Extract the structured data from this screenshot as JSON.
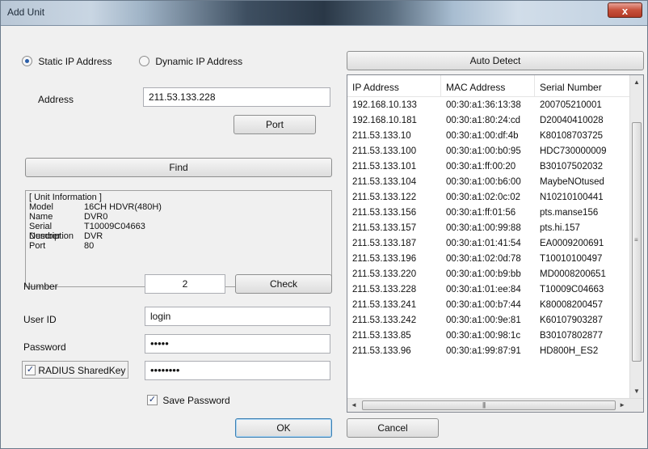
{
  "window": {
    "title": "Add Unit",
    "close_glyph": "x"
  },
  "connection": {
    "static_label": "Static IP Address",
    "dynamic_label": "Dynamic IP Address",
    "selected": "static"
  },
  "address": {
    "label": "Address",
    "value": "211.53.133.228"
  },
  "buttons": {
    "port": "Port",
    "find": "Find",
    "check": "Check",
    "auto_detect": "Auto Detect",
    "ok": "OK",
    "cancel": "Cancel"
  },
  "unit_info": {
    "heading": "[ Unit Information ]",
    "rows": [
      {
        "label": "Model",
        "value": "16CH HDVR(480H)"
      },
      {
        "label": "Name",
        "value": "DVR0"
      },
      {
        "label": "Serial Number",
        "value": "T10009C04663"
      },
      {
        "label": "Description",
        "value": "DVR"
      },
      {
        "label": "Port",
        "value": "80"
      }
    ]
  },
  "form": {
    "number_label": "Number",
    "number_value": "2",
    "userid_label": "User ID",
    "userid_value": "login",
    "password_label": "Password",
    "password_value": "•••••",
    "radius_label": "RADIUS SharedKey",
    "radius_checked": true,
    "radius_value": "••••••••",
    "save_password_label": "Save Password",
    "save_password_checked": true
  },
  "device_list": {
    "columns": [
      "IP Address",
      "MAC Address",
      "Serial Number"
    ],
    "rows": [
      [
        "192.168.10.133",
        "00:30:a1:36:13:38",
        "200705210001"
      ],
      [
        "192.168.10.181",
        "00:30:a1:80:24:cd",
        "D20040410028"
      ],
      [
        "211.53.133.10",
        "00:30:a1:00:df:4b",
        "K80108703725"
      ],
      [
        "211.53.133.100",
        "00:30:a1:00:b0:95",
        "HDC730000009"
      ],
      [
        "211.53.133.101",
        "00:30:a1:ff:00:20",
        "B30107502032"
      ],
      [
        "211.53.133.104",
        "00:30:a1:00:b6:00",
        "MaybeNOtused"
      ],
      [
        "211.53.133.122",
        "00:30:a1:02:0c:02",
        "N10210100441"
      ],
      [
        "211.53.133.156",
        "00:30:a1:ff:01:56",
        "pts.manse156"
      ],
      [
        "211.53.133.157",
        "00:30:a1:00:99:88",
        "pts.hi.157"
      ],
      [
        "211.53.133.187",
        "00:30:a1:01:41:54",
        "EA0009200691"
      ],
      [
        "211.53.133.196",
        "00:30:a1:02:0d:78",
        "T10010100497"
      ],
      [
        "211.53.133.220",
        "00:30:a1:00:b9:bb",
        "MD0008200651"
      ],
      [
        "211.53.133.228",
        "00:30:a1:01:ee:84",
        "T10009C04663"
      ],
      [
        "211.53.133.241",
        "00:30:a1:00:b7:44",
        "K80008200457"
      ],
      [
        "211.53.133.242",
        "00:30:a1:00:9e:81",
        "K60107903287"
      ],
      [
        "211.53.133.85",
        "00:30:a1:00:98:1c",
        "B30107802877"
      ],
      [
        "211.53.133.96",
        "00:30:a1:99:87:91",
        "HD800H_ES2"
      ]
    ],
    "scroll_up": "▲",
    "scroll_down": "▼",
    "scroll_left": "◄",
    "scroll_right": "►",
    "v_grip": "≡",
    "h_grip": "|||"
  }
}
